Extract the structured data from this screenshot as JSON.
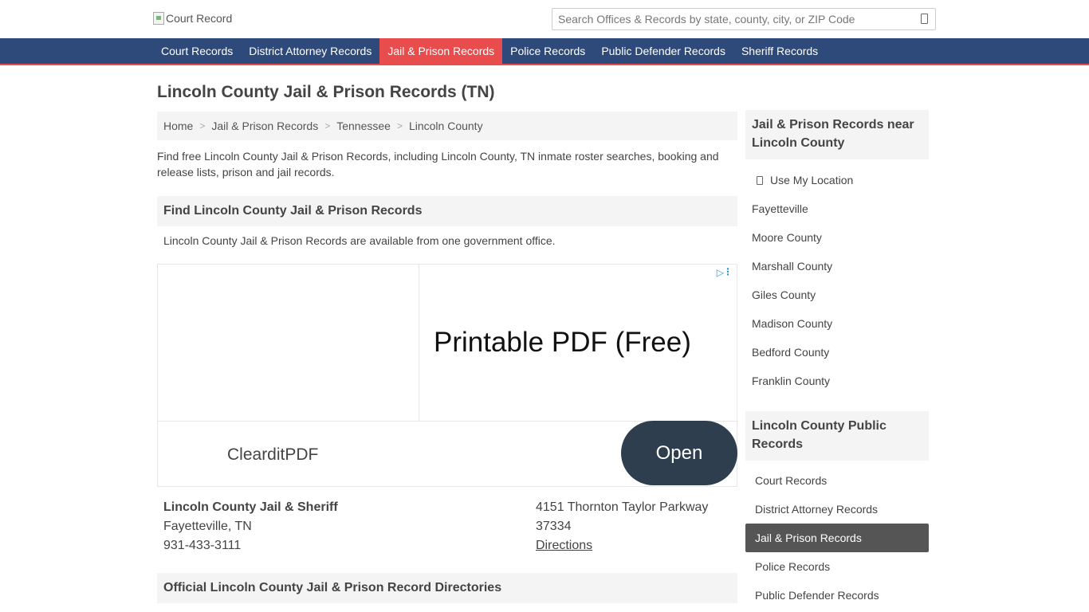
{
  "header": {
    "logo_alt": "Court Record",
    "search_placeholder": "Search Offices & Records by state, county, city, or ZIP Code"
  },
  "nav": {
    "items": [
      {
        "label": "Court Records"
      },
      {
        "label": "District Attorney Records"
      },
      {
        "label": "Jail & Prison Records",
        "active": true
      },
      {
        "label": "Police Records"
      },
      {
        "label": "Public Defender Records"
      },
      {
        "label": "Sheriff Records"
      }
    ]
  },
  "main": {
    "title": "Lincoln County Jail & Prison Records (TN)",
    "breadcrumb": [
      "Home",
      "Jail & Prison Records",
      "Tennessee",
      "Lincoln County"
    ],
    "intro": "Find free Lincoln County Jail & Prison Records, including Lincoln County, TN inmate roster searches, booking and release lists, prison and jail records.",
    "find_heading": "Find Lincoln County Jail & Prison Records",
    "availability": "Lincoln County Jail & Prison Records are available from one government office.",
    "directories_heading": "Official Lincoln County Jail & Prison Record Directories"
  },
  "ad": {
    "headline": "Printable PDF (Free)",
    "brand": "ClearditPDF",
    "button_label": "Open"
  },
  "office": {
    "name": "Lincoln County Jail & Sheriff",
    "city": "Fayetteville, TN",
    "phone": "931-433-3111",
    "street": "4151 Thornton Taylor Parkway",
    "zip": "37334",
    "directions_label": "Directions"
  },
  "sidebar": {
    "nearby_heading": "Jail & Prison Records near Lincoln County",
    "use_location_label": "Use My Location",
    "nearby": [
      "Fayetteville",
      "Moore County",
      "Marshall County",
      "Giles County",
      "Madison County",
      "Bedford County",
      "Franklin County"
    ],
    "public_heading": "Lincoln County Public Records",
    "public_links": [
      {
        "label": "Court Records"
      },
      {
        "label": "District Attorney Records"
      },
      {
        "label": "Jail & Prison Records",
        "active": true
      },
      {
        "label": "Police Records"
      },
      {
        "label": "Public Defender Records"
      }
    ]
  },
  "colors": {
    "nav_bg": "#2d4a7a",
    "accent_red": "#e84c4c",
    "ad_button": "#2e3e4e",
    "panel_bg": "#f4f4f4",
    "active_sidebar": "#555555"
  }
}
